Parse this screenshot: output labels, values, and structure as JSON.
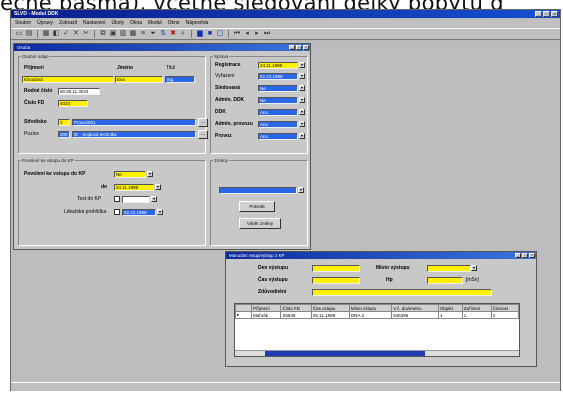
{
  "header_text": "lečně pásma), včetně sledování délky pobytu d",
  "app": {
    "title": "SLVD - Modul DDK",
    "window_buttons": [
      "_",
      "□",
      "×"
    ],
    "menu": [
      "Soubor",
      "Úpravy",
      "Zobrazit",
      "Nastavení",
      "Úkoly",
      "Okna",
      "Modul",
      "Okno",
      "Nápověda"
    ]
  },
  "osoba": {
    "title": "Osoba",
    "group_main": "Osobní údaje",
    "prijmeni_label": "Příjmení",
    "jmeno_label": "Jméno",
    "titul_label": "Titul",
    "prijmeni_value": "Kloudová",
    "jmeno_value": "Eva",
    "titul_value": "ing.",
    "rodne_cislo_label": "Rodné číslo",
    "rodne_cislo_value": "60.55.11.4024",
    "cislo_fd_label": "Číslo FD",
    "cislo_fd_value": "4024",
    "stredisko_label": "Středisko",
    "stredisko_code": "2",
    "stredisko_name": "Provoz001",
    "pozice_label": "Pozice",
    "pozice_code": "200",
    "pozice_name": "IE - Sejdová technika",
    "group_sprava": "Správa",
    "registrace_label": "Registrace",
    "registrace_value": "24.11.1999",
    "vyrazeni_label": "Vyřazení",
    "vyrazeni_value": "02.12.1999",
    "sledovana_label": "Sledovaná",
    "sledovana_value": "Ne",
    "admin_ddk_label": "Admin. DDK",
    "admin_ddk_value": "Ne",
    "ddk_label": "DDK",
    "ddk_value": "Ano",
    "admin_provozu_label": "Admin. provozu",
    "admin_provozu_value": "Ano",
    "provoz_label": "Provoz",
    "provoz_value": "Ano",
    "group_povoleni": "Povolení ke vstupu do KP",
    "povoleni_label": "Povolení ke vstupu do KP",
    "povoleni_value": "Ne",
    "do_label": "do",
    "do_value": "24.11.1999",
    "test_label": "Test do KP",
    "lekarska_label": "Lékařská prohlídka",
    "lekarska_value": "02.12.1999",
    "group_zmeny": "Změny",
    "potvrdit_label": "Potvrdit",
    "vyber_zmeny_label": "Výběr změny"
  },
  "vstup": {
    "title": "Manuální vstup/výstup z KP",
    "den_label": "Den výstupu",
    "misto_label": "Místo výstupu",
    "cas_label": "Čas výstupu",
    "hp_label": "Hp",
    "unit": "[mSv]",
    "zduvodneni_label": "Zdůvodnění",
    "columns": [
      "Příjmení",
      "Číslo FD",
      "Čas vstupu",
      "Místo vstupu",
      "V.č. dozimetru",
      "Objekt",
      "Zařízení",
      "Činnost"
    ],
    "rows": [
      [
        "Mahrák",
        "X6549",
        "25.11.1999",
        "DRA.2",
        "845396",
        "1",
        "1",
        "1"
      ]
    ]
  }
}
